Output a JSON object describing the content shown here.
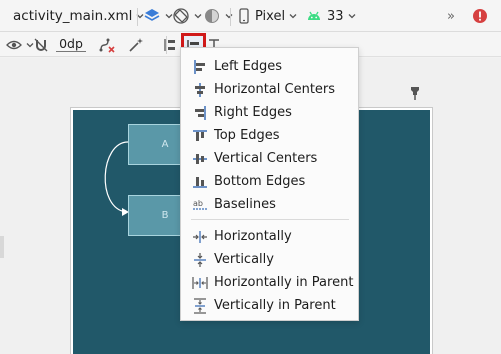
{
  "toolbar": {
    "file_name": "activity_main.xml",
    "device": "Pixel",
    "api_level": "33",
    "overflow": "»",
    "default_margin": "0dp"
  },
  "canvas": {
    "widget_a": "A",
    "widget_b": "B"
  },
  "align_menu": {
    "edge_items": [
      {
        "label": "Left Edges",
        "icon": "align-left-edges-icon"
      },
      {
        "label": "Horizontal Centers",
        "icon": "align-horizontal-centers-icon"
      },
      {
        "label": "Right Edges",
        "icon": "align-right-edges-icon"
      },
      {
        "label": "Top Edges",
        "icon": "align-top-edges-icon"
      },
      {
        "label": "Vertical Centers",
        "icon": "align-vertical-centers-icon"
      },
      {
        "label": "Bottom Edges",
        "icon": "align-bottom-edges-icon"
      },
      {
        "label": "Baselines",
        "icon": "align-baselines-icon"
      }
    ],
    "center_items": [
      {
        "label": "Horizontally",
        "icon": "center-horizontally-icon"
      },
      {
        "label": "Vertically",
        "icon": "center-vertically-icon"
      },
      {
        "label": "Horizontally in Parent",
        "icon": "center-horizontally-in-parent-icon"
      },
      {
        "label": "Vertically in Parent",
        "icon": "center-vertically-in-parent-icon"
      }
    ]
  },
  "colors": {
    "blueprint": "#215869",
    "highlight": "#d01919",
    "accent_blue": "#3b7dd8",
    "android_green": "#3ddc84"
  }
}
